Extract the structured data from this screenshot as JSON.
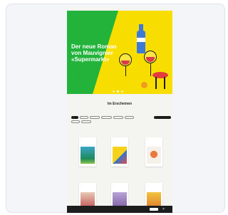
{
  "app": {
    "top_title": "···"
  },
  "hero": {
    "title": "Der neue Roman von Mauvignier «Supermarkt»",
    "subtitle": "···",
    "slides": 3,
    "active_slide": 2
  },
  "section": {
    "title": "Im Erscheinen"
  },
  "filters": {
    "chips": [
      "···",
      "···",
      "···",
      "···",
      "···",
      "···",
      "···",
      "···"
    ],
    "sort_label": "···"
  },
  "books": [
    {
      "title": "···"
    },
    {
      "title": "···"
    },
    {
      "title": "···"
    },
    {
      "title": "···"
    },
    {
      "title": "···"
    },
    {
      "title": "···"
    }
  ],
  "cookie_bar": {
    "text": "···",
    "accept_label": "···",
    "close_glyph": "×"
  },
  "colors": {
    "hero_green": "#23b33b",
    "hero_yellow": "#f7de00",
    "bottle_blue": "#3d7ad8",
    "accent_red": "#e23c3c",
    "cookie_bg": "#1d1d1d"
  }
}
